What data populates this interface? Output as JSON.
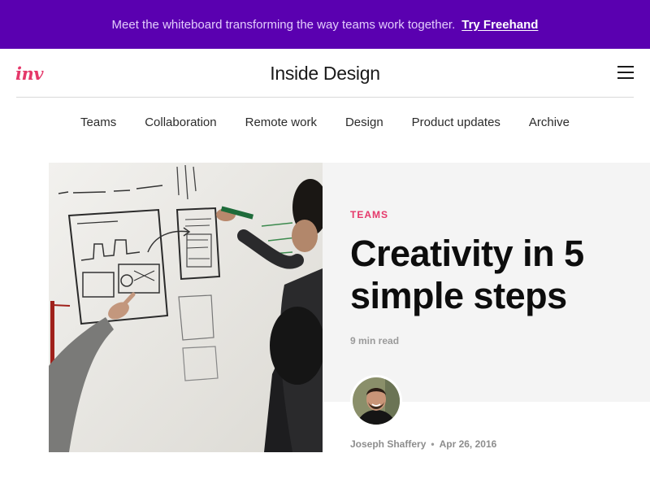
{
  "banner": {
    "message": "Meet the whiteboard transforming the way teams work together.",
    "cta_label": "Try Freehand",
    "background": "#5a00b0"
  },
  "header": {
    "logo": "inv",
    "title": "Inside Design",
    "menu_icon": "hamburger-menu-icon",
    "logo_color": "#e5386a"
  },
  "nav": {
    "items": [
      "Teams",
      "Collaboration",
      "Remote work",
      "Design",
      "Product updates",
      "Archive"
    ]
  },
  "article": {
    "category": "TEAMS",
    "title": "Creativity in 5 simple steps",
    "read_time": "9 min read",
    "author": "Joseph Shaffery",
    "separator": "•",
    "date": "Apr 26, 2016",
    "accent": "#e5386a"
  }
}
